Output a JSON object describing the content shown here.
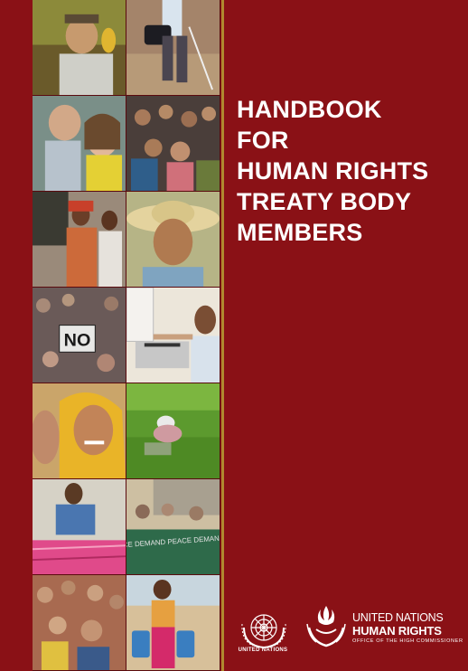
{
  "title_lines": [
    "HANDBOOK",
    "FOR",
    "HUMAN RIGHTS",
    "TREATY BODY",
    "MEMBERS"
  ],
  "un_label": "UNITED NATIONS",
  "ohchr": {
    "line1": "UNITED NATIONS",
    "line2": "HUMAN RIGHTS",
    "line3": "OFFICE OF THE HIGH COMMISSIONER"
  },
  "photo_captions": {
    "no_sign": "NO",
    "banner": "DEMAND JUSTICE DEMAND PEACE DEMAND A PUBLIC ENQ"
  },
  "colors": {
    "background": "#8a1116",
    "divider": "#b0882f",
    "text": "#ffffff"
  }
}
